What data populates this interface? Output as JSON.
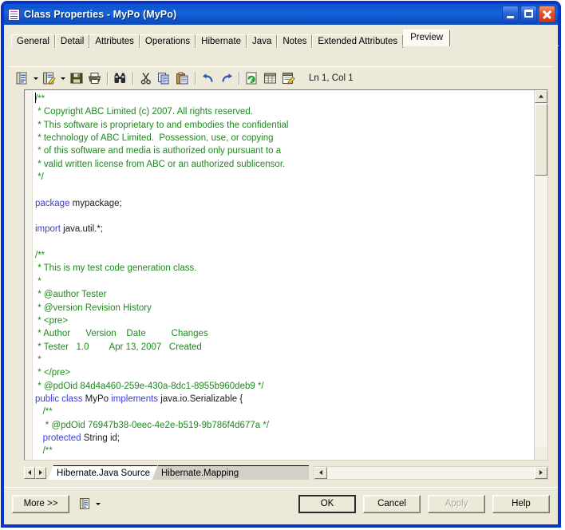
{
  "window": {
    "title": "Class Properties - MyPo (MyPo)",
    "icon": "properties-icon",
    "minimize_label": "_",
    "maximize_label": "□",
    "close_label": "X",
    "border_color": "#0a36c8",
    "titlebar_color": "#1763dc"
  },
  "tabs": [
    {
      "label": "General",
      "active": false
    },
    {
      "label": "Detail",
      "active": false
    },
    {
      "label": "Attributes",
      "active": false
    },
    {
      "label": "Operations",
      "active": false
    },
    {
      "label": "Hibernate",
      "active": false
    },
    {
      "label": "Java",
      "active": false
    },
    {
      "label": "Notes",
      "active": false
    },
    {
      "label": "Extended Attributes",
      "active": false
    },
    {
      "label": "Preview",
      "active": true
    }
  ],
  "toolbar": {
    "buttons": [
      {
        "name": "list-icon",
        "has_dropdown": true
      },
      {
        "name": "edit-note-icon",
        "has_dropdown": true
      },
      {
        "name": "save-icon",
        "has_dropdown": false
      },
      {
        "name": "print-icon",
        "has_dropdown": false
      },
      {
        "name": "find-binoculars-icon",
        "has_dropdown": false
      },
      {
        "name": "cut-scissors-icon",
        "has_dropdown": false
      },
      {
        "name": "copy-icon",
        "has_dropdown": false
      },
      {
        "name": "paste-icon",
        "has_dropdown": false
      },
      {
        "name": "undo-icon",
        "has_dropdown": false
      },
      {
        "name": "redo-icon",
        "has_dropdown": false
      },
      {
        "name": "refresh-icon",
        "has_dropdown": false
      },
      {
        "name": "table-grid-icon",
        "has_dropdown": false
      },
      {
        "name": "edit-document-icon",
        "has_dropdown": false
      }
    ],
    "status": "Ln 1, Col 1"
  },
  "editor": {
    "colors": {
      "comment": "#1e8a1e",
      "keyword": "#3b3bdb",
      "text": "#1a1a1a",
      "background": "#ffffff"
    },
    "lines": [
      {
        "indent": 0,
        "segments": [
          {
            "t": "/**",
            "c": "cm"
          }
        ]
      },
      {
        "indent": 0,
        "segments": [
          {
            "t": " * Copyright ABC Limited (c) 2007. All rights reserved.",
            "c": "cm"
          }
        ]
      },
      {
        "indent": 0,
        "segments": [
          {
            "t": " * This software is proprietary to and embodies the confidential",
            "c": "cm"
          }
        ]
      },
      {
        "indent": 0,
        "segments": [
          {
            "t": " * technology of ABC Limited.  Possession, use, or copying",
            "c": "cm"
          }
        ]
      },
      {
        "indent": 0,
        "segments": [
          {
            "t": " * of this software and media is authorized only pursuant to a",
            "c": "cm"
          }
        ]
      },
      {
        "indent": 0,
        "segments": [
          {
            "t": " * valid written license from ABC or an authorized sublicensor.",
            "c": "cm"
          }
        ]
      },
      {
        "indent": 0,
        "segments": [
          {
            "t": " */",
            "c": "cm"
          }
        ]
      },
      {
        "indent": 0,
        "segments": [
          {
            "t": "",
            "c": ""
          }
        ]
      },
      {
        "indent": 0,
        "segments": [
          {
            "t": "package",
            "c": "kw"
          },
          {
            "t": " mypackage;",
            "c": ""
          }
        ]
      },
      {
        "indent": 0,
        "segments": [
          {
            "t": "",
            "c": ""
          }
        ]
      },
      {
        "indent": 0,
        "segments": [
          {
            "t": "import",
            "c": "kw"
          },
          {
            "t": " java.util.*;",
            "c": ""
          }
        ]
      },
      {
        "indent": 0,
        "segments": [
          {
            "t": "",
            "c": ""
          }
        ]
      },
      {
        "indent": 0,
        "segments": [
          {
            "t": "/**",
            "c": "cm"
          }
        ]
      },
      {
        "indent": 0,
        "segments": [
          {
            "t": " * This is my test code generation class.",
            "c": "cm"
          }
        ]
      },
      {
        "indent": 0,
        "segments": [
          {
            "t": " *",
            "c": "cm"
          }
        ]
      },
      {
        "indent": 0,
        "segments": [
          {
            "t": " * @author Tester",
            "c": "cm"
          }
        ]
      },
      {
        "indent": 0,
        "segments": [
          {
            "t": " * @version Revision History",
            "c": "cm"
          }
        ]
      },
      {
        "indent": 0,
        "segments": [
          {
            "t": " * <pre>",
            "c": "cm"
          }
        ]
      },
      {
        "indent": 0,
        "segments": [
          {
            "t": " * Author      Version    Date          Changes",
            "c": "cm"
          }
        ]
      },
      {
        "indent": 0,
        "segments": [
          {
            "t": " * Tester   1.0        Apr 13, 2007   Created",
            "c": "cm"
          }
        ]
      },
      {
        "indent": 0,
        "segments": [
          {
            "t": " *",
            "c": "cm"
          }
        ]
      },
      {
        "indent": 0,
        "segments": [
          {
            "t": " * </pre>",
            "c": "cm"
          }
        ]
      },
      {
        "indent": 0,
        "segments": [
          {
            "t": " * @pdOid 84d4a460-259e-430a-8dc1-8955b960deb9 */",
            "c": "cm"
          }
        ]
      },
      {
        "indent": 0,
        "segments": [
          {
            "t": "public class",
            "c": "kw"
          },
          {
            "t": " MyPo ",
            "c": ""
          },
          {
            "t": "implements",
            "c": "kw"
          },
          {
            "t": " java.io.Serializable {",
            "c": ""
          }
        ]
      },
      {
        "indent": 0,
        "segments": [
          {
            "t": "   /**",
            "c": "cm"
          }
        ]
      },
      {
        "indent": 0,
        "segments": [
          {
            "t": "    * @pdOid 76947b38-0eec-4e2e-b519-9b786f4d677a */",
            "c": "cm"
          }
        ]
      },
      {
        "indent": 0,
        "segments": [
          {
            "t": "   ",
            "c": ""
          },
          {
            "t": "protected",
            "c": "kw"
          },
          {
            "t": " String id;",
            "c": ""
          }
        ]
      },
      {
        "indent": 0,
        "segments": [
          {
            "t": "   /**",
            "c": "cm"
          }
        ]
      }
    ]
  },
  "sheet_tabs": [
    {
      "label": "Hibernate.Java Source",
      "active": true
    },
    {
      "label": "Hibernate.Mapping",
      "active": false
    }
  ],
  "sheet_nav": {
    "prev_label": "◀",
    "next_label": "▶"
  },
  "footer": {
    "more_label": "More >>",
    "menu_icon": "list-menu-icon",
    "buttons": [
      {
        "label": "OK",
        "default": true,
        "disabled": false,
        "name": "ok-button"
      },
      {
        "label": "Cancel",
        "default": false,
        "disabled": false,
        "name": "cancel-button"
      },
      {
        "label": "Apply",
        "default": false,
        "disabled": true,
        "name": "apply-button"
      },
      {
        "label": "Help",
        "default": false,
        "disabled": false,
        "name": "help-button"
      }
    ]
  }
}
